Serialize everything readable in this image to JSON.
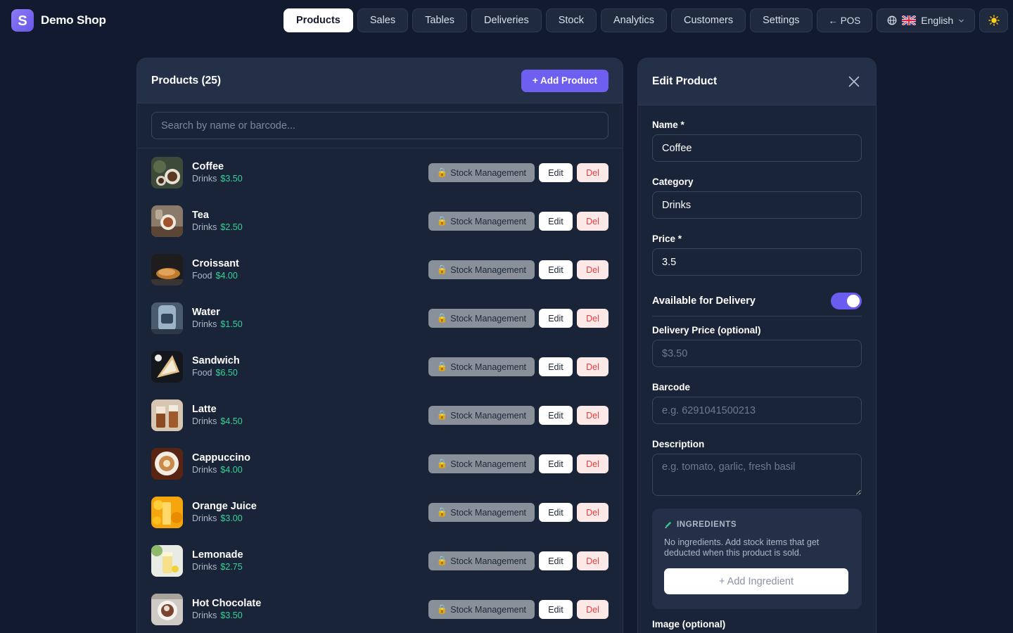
{
  "brand": {
    "name": "Demo Shop",
    "logo_letter": "S"
  },
  "nav": {
    "items": [
      {
        "label": "Products",
        "active": true
      },
      {
        "label": "Sales"
      },
      {
        "label": "Tables"
      },
      {
        "label": "Deliveries"
      },
      {
        "label": "Stock"
      },
      {
        "label": "Analytics"
      },
      {
        "label": "Customers"
      },
      {
        "label": "Settings"
      }
    ],
    "pos_label": "← POS",
    "language": "English",
    "language_flag": "uk-flag-icon",
    "theme_icon": "sun-icon"
  },
  "products_panel": {
    "title": "Products (25)",
    "add_button": "+ Add Product",
    "search_placeholder": "Search by name or barcode...",
    "stock_label": "Stock Management",
    "edit_label": "Edit",
    "del_label": "Del",
    "items": [
      {
        "name": "Coffee",
        "category": "Drinks",
        "price": "$3.50"
      },
      {
        "name": "Tea",
        "category": "Drinks",
        "price": "$2.50"
      },
      {
        "name": "Croissant",
        "category": "Food",
        "price": "$4.00"
      },
      {
        "name": "Water",
        "category": "Drinks",
        "price": "$1.50"
      },
      {
        "name": "Sandwich",
        "category": "Food",
        "price": "$6.50"
      },
      {
        "name": "Latte",
        "category": "Drinks",
        "price": "$4.50"
      },
      {
        "name": "Cappuccino",
        "category": "Drinks",
        "price": "$4.00"
      },
      {
        "name": "Orange Juice",
        "category": "Drinks",
        "price": "$3.00"
      },
      {
        "name": "Lemonade",
        "category": "Drinks",
        "price": "$2.75"
      },
      {
        "name": "Hot Chocolate",
        "category": "Drinks",
        "price": "$3.50"
      }
    ]
  },
  "edit_panel": {
    "title": "Edit Product",
    "name_label": "Name *",
    "name_value": "Coffee",
    "category_label": "Category",
    "category_value": "Drinks",
    "price_label": "Price *",
    "price_value": "3.5",
    "delivery_toggle_label": "Available for Delivery",
    "delivery_enabled": true,
    "delivery_price_label": "Delivery Price (optional)",
    "delivery_price_placeholder": "$3.50",
    "barcode_label": "Barcode",
    "barcode_placeholder": "e.g. 6291041500213",
    "description_label": "Description",
    "description_placeholder": "e.g. tomato, garlic, fresh basil",
    "ingredients": {
      "heading": "INGREDIENTS",
      "empty_text": "No ingredients. Add stock items that get deducted when this product is sold.",
      "add_button": "+ Add Ingredient"
    },
    "image_label": "Image (optional)",
    "image_remove": "x"
  },
  "colors": {
    "background": "#111a2e",
    "accent": "#6f5ff0",
    "price_green": "#34d399",
    "danger": "#e53e3e"
  }
}
